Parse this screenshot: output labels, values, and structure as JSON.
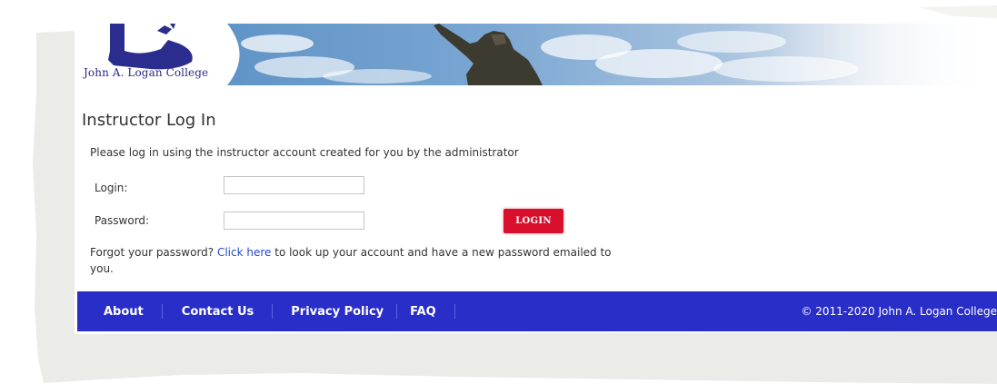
{
  "branding": {
    "college_name": "John A. Logan College"
  },
  "page": {
    "title": "Instructor Log In",
    "instructions": "Please log in using the instructor account created for you by the administrator"
  },
  "form": {
    "login_label": "Login:",
    "login_value": "",
    "password_label": "Password:",
    "password_value": "",
    "login_button": "LOGIN"
  },
  "forgot": {
    "prefix": "Forgot your password? ",
    "link": "Click here",
    "suffix": " to look up your account and have a new password emailed to you."
  },
  "footer": {
    "links": [
      "About",
      "Contact Us",
      "Privacy Policy",
      "FAQ"
    ],
    "copyright": "© 2011-2020 John A. Logan College"
  },
  "colors": {
    "footer_bg": "#2a2ec8",
    "login_button": "#d8102e",
    "link": "#2548c9",
    "logo": "#2a2a8a"
  }
}
